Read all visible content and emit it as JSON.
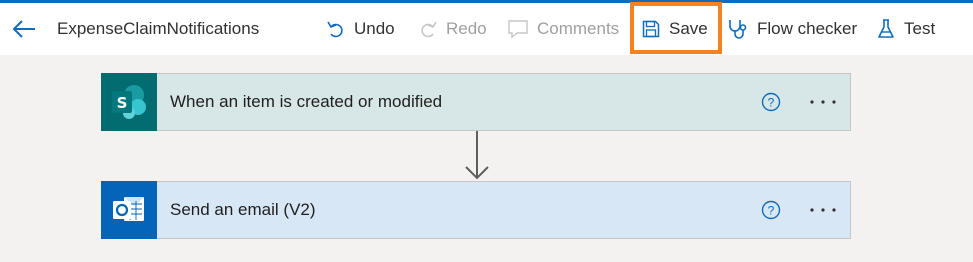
{
  "toolbar": {
    "title": "ExpenseClaimNotifications",
    "undo_label": "Undo",
    "redo_label": "Redo",
    "comments_label": "Comments",
    "save_label": "Save",
    "flow_checker_label": "Flow checker",
    "test_label": "Test"
  },
  "steps": [
    {
      "title": "When an item is created or modified",
      "icon": "sharepoint-icon"
    },
    {
      "title": "Send an email (V2)",
      "icon": "outlook-icon"
    }
  ],
  "colors": {
    "accent": "#0f6cbd",
    "highlight": "#f58220",
    "trigger_bg": "#d7e6e6",
    "trigger_icon_bg": "#036c70",
    "action_bg": "#d7e7f6",
    "action_icon_bg": "#0364b8"
  }
}
